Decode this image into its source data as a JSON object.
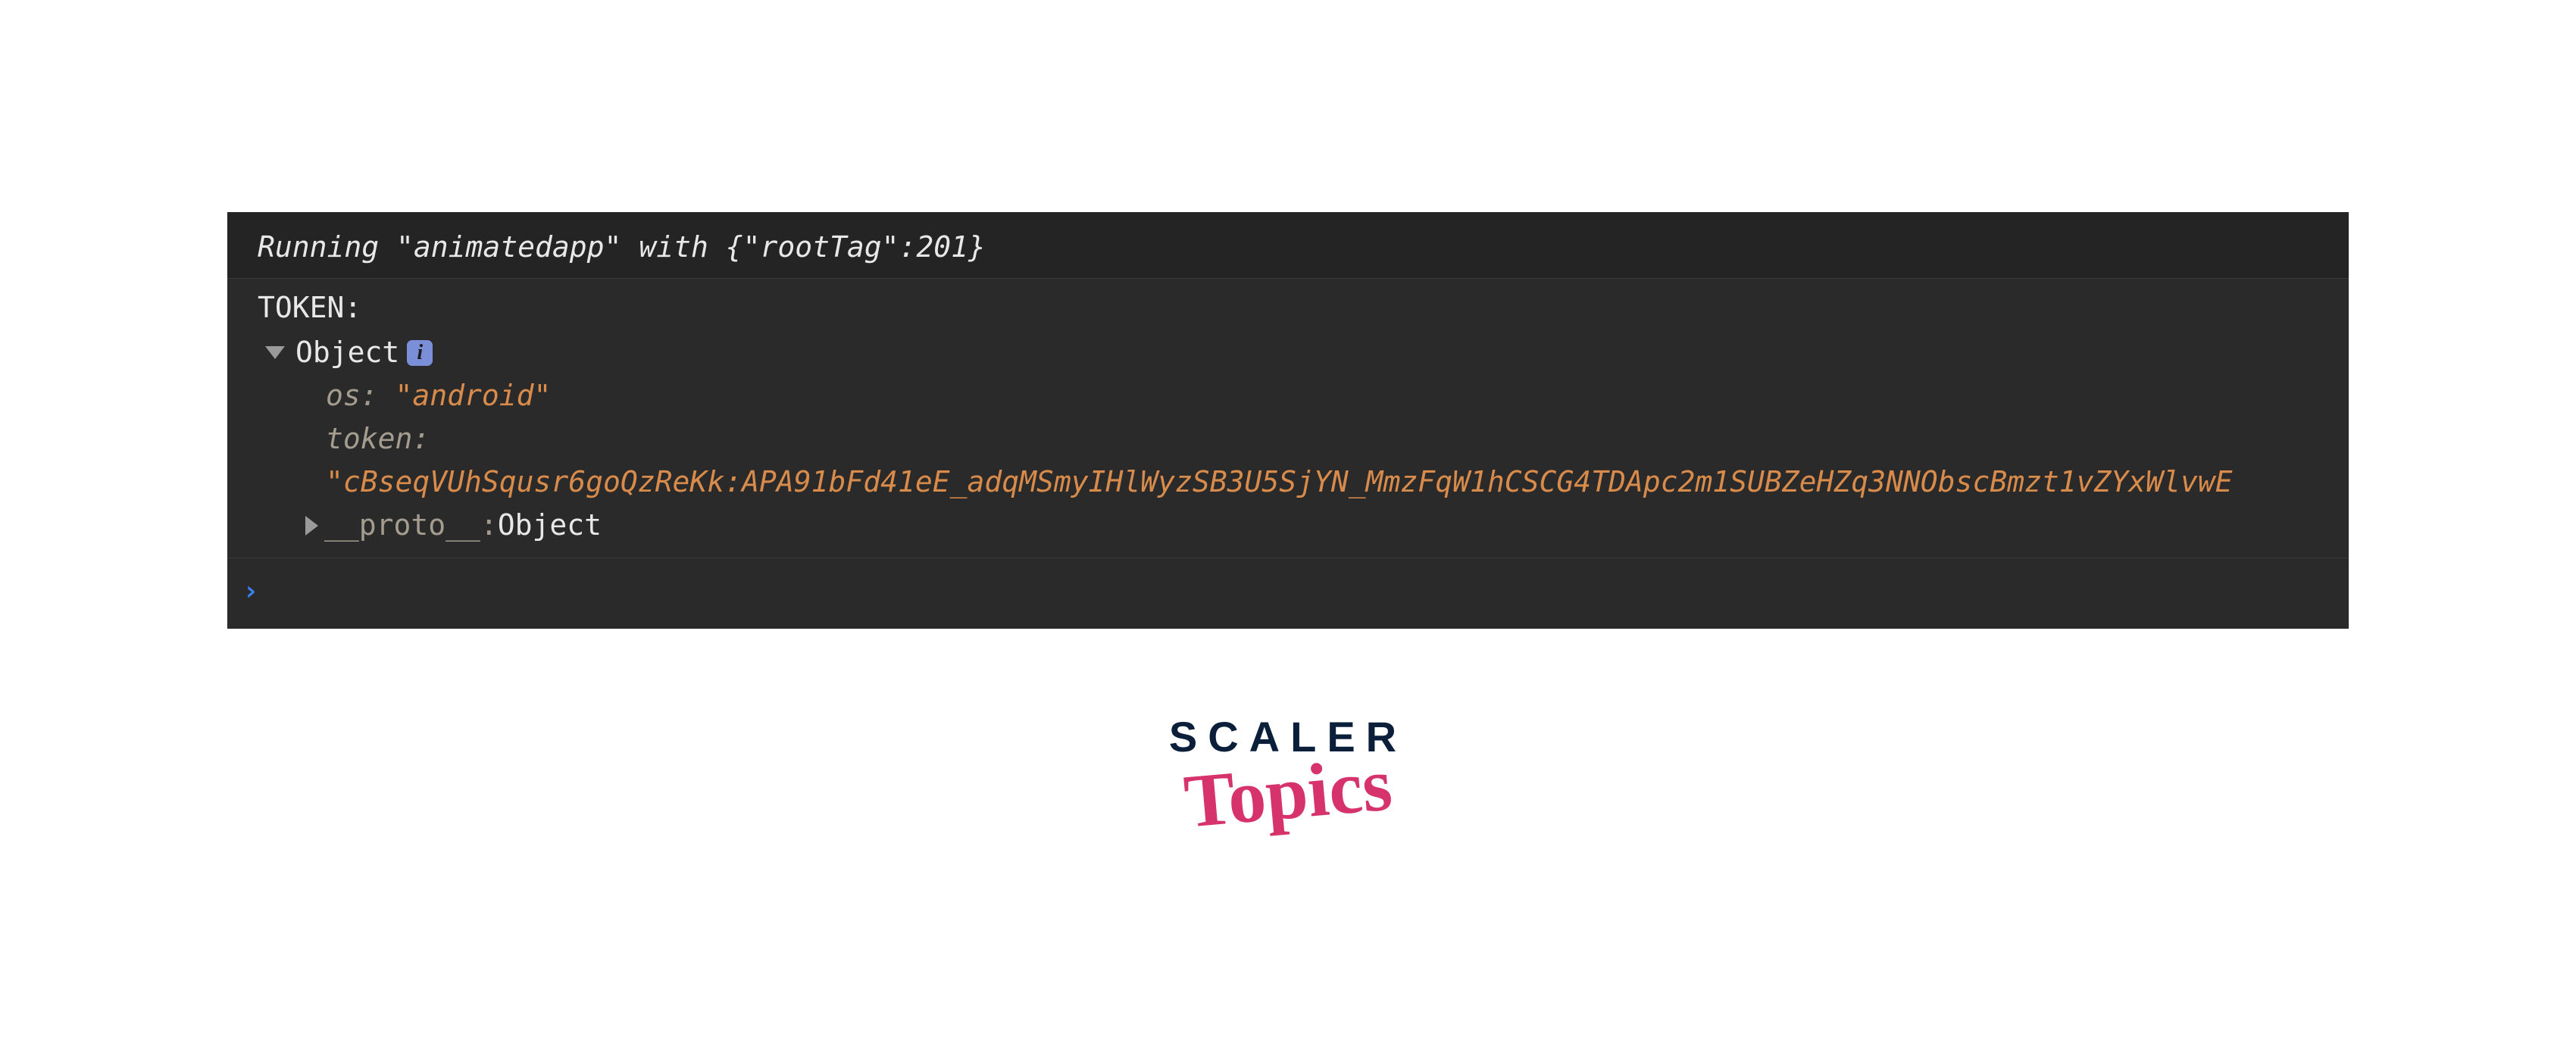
{
  "console": {
    "running_line": "Running \"animatedapp\" with {\"rootTag\":201}",
    "token_label": "TOKEN:",
    "object_label": "Object",
    "info_badge": "i",
    "props": {
      "os_key": "os",
      "os_val": "\"android\"",
      "token_key": "token",
      "token_val": "\"cBseqVUhSqusr6goQzReKk:APA91bFd41eE_adqMSmyIHlWyzSB3U5SjYN_MmzFqW1hCSCG4TDApc2m1SUBZeHZq3NNObscBmzt1vZYxWlvwE"
    },
    "proto_key": "__proto__",
    "proto_val": "Object",
    "prompt": "›"
  },
  "logo": {
    "line1": "SCALER",
    "line2": "Topics"
  }
}
